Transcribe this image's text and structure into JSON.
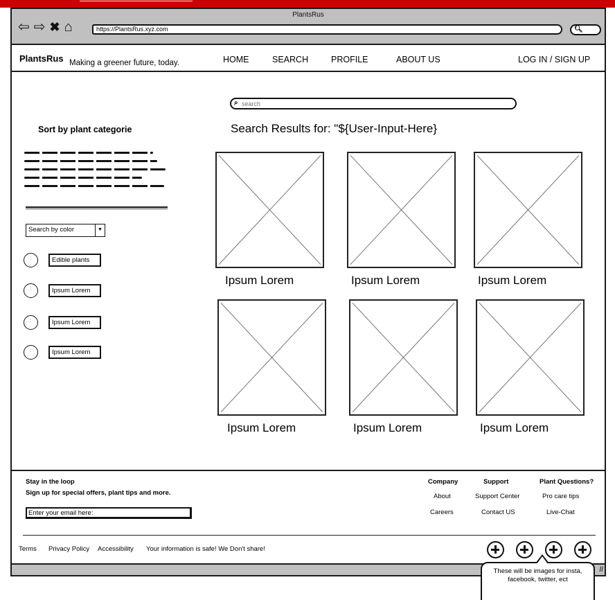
{
  "browser": {
    "title": "PlantsRus",
    "url": "https://PlantsRus.xyz.com",
    "nav_icons": [
      "back-arrow-icon",
      "forward-arrow-icon",
      "close-icon",
      "home-icon"
    ],
    "search_icon": "search-icon"
  },
  "header": {
    "brand": "PlantsRus",
    "tagline": "Making a greener future, today.",
    "nav": [
      "HOME",
      "SEARCH",
      "PROFILE",
      "ABOUT US"
    ],
    "login": "LOG IN / SIGN UP"
  },
  "search": {
    "placeholder": "search",
    "results_title": "Search Results for: \"${User-Input-Here}"
  },
  "sidebar": {
    "title": "Sort by plant categorie",
    "color_select": "Search by color",
    "categories": [
      "Edible plants",
      "Ipsum Lorem",
      "Ipsum Lorem",
      "Ipsum Lorem"
    ]
  },
  "results": [
    {
      "caption": "Ipsum Lorem"
    },
    {
      "caption": "Ipsum Lorem"
    },
    {
      "caption": "Ipsum Lorem"
    },
    {
      "caption": "Ipsum Lorem"
    },
    {
      "caption": "Ipsum Lorem"
    },
    {
      "caption": "Ipsum Lorem"
    }
  ],
  "footer": {
    "newsletter_title": "Stay in the loop",
    "newsletter_text": "Sign up for special offers, plant tips and more.",
    "email_placeholder": "Enter your email here:",
    "columns": [
      {
        "heading": "Company",
        "links": [
          "About",
          "Careers"
        ]
      },
      {
        "heading": "Support",
        "links": [
          "Support Center",
          "Contact US"
        ]
      },
      {
        "heading": "Plant Questions?",
        "links": [
          "Pro care tips",
          "Live-Chat"
        ]
      }
    ],
    "legal": [
      "Terms",
      "Privacy Policy",
      "Accessibility"
    ],
    "privacy_note": "Your information is safe! We Don't share!",
    "social_icons": [
      "plus-circle-icon",
      "plus-circle-icon",
      "plus-circle-icon",
      "plus-circle-icon"
    ]
  },
  "annotation": {
    "callout": "These will be images for insta, facebook, twitter, ect"
  },
  "colors": {
    "topbar": "#cc0000",
    "chrome": "#c0c0c0"
  }
}
